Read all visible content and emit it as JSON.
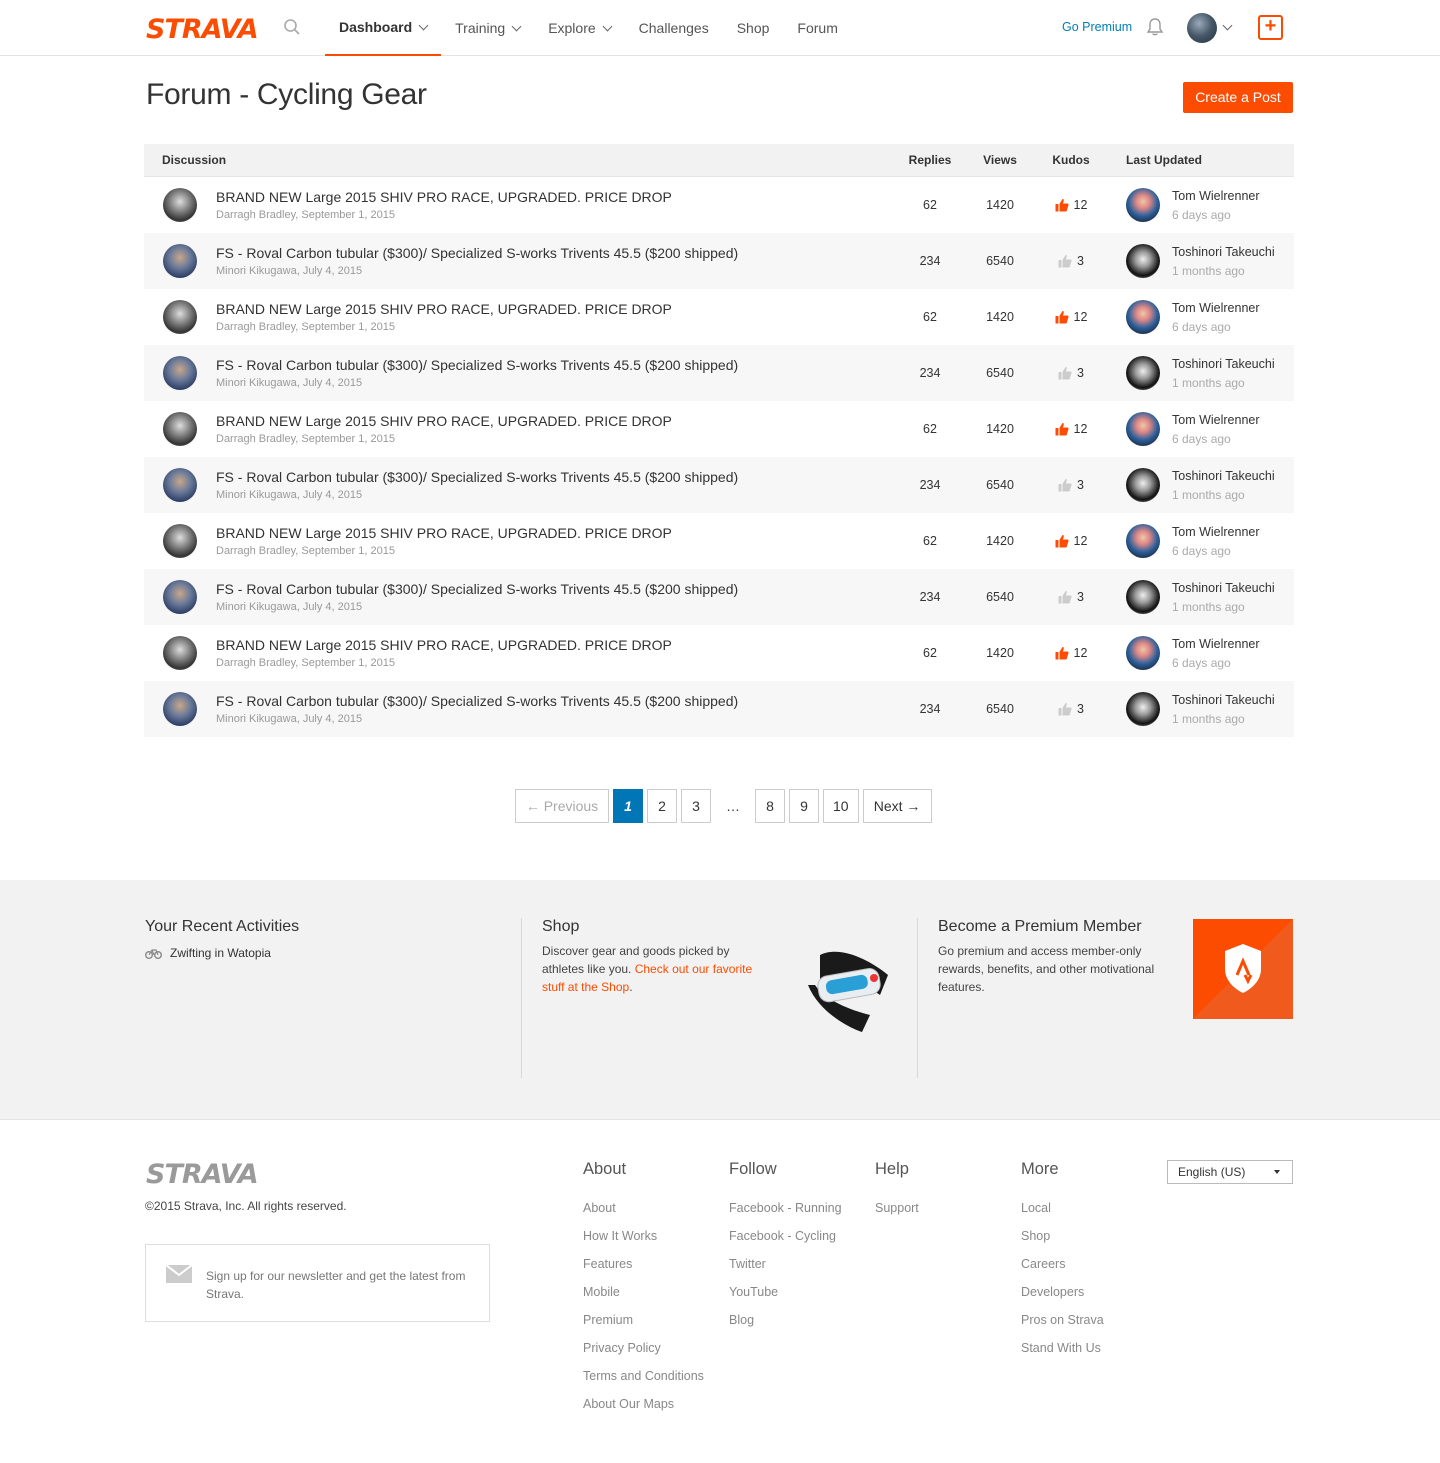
{
  "brand": {
    "logo_text": "STRAVA",
    "accent": "#fc4c02",
    "link_blue": "#007fb6"
  },
  "nav": {
    "items": [
      {
        "label": "Dashboard",
        "dropdown": true,
        "active": true
      },
      {
        "label": "Training",
        "dropdown": true,
        "active": false
      },
      {
        "label": "Explore",
        "dropdown": true,
        "active": false
      },
      {
        "label": "Challenges",
        "dropdown": false,
        "active": false
      },
      {
        "label": "Shop",
        "dropdown": false,
        "active": false
      },
      {
        "label": "Forum",
        "dropdown": false,
        "active": false
      }
    ],
    "go_premium": "Go Premium",
    "upload_symbol": "+"
  },
  "page": {
    "title": "Forum - Cycling Gear",
    "create_post": "Create a Post"
  },
  "table": {
    "headers": {
      "discussion": "Discussion",
      "replies": "Replies",
      "views": "Views",
      "kudos": "Kudos",
      "last_updated": "Last Updated"
    },
    "rows": [
      {
        "title": "BRAND NEW Large 2015 SHIV PRO RACE, UPGRADED. PRICE DROP",
        "meta": "Darragh Bradley, September 1, 2015",
        "replies": "62",
        "views": "1420",
        "kudos": "12",
        "kudos_active": true,
        "last_name": "Tom Wielrenner",
        "last_time": "6 days ago"
      },
      {
        "title": "FS - Roval Carbon tubular ($300)/ Specialized S-works Trivents 45.5 ($200 shipped)",
        "meta": "Minori Kikugawa, July 4, 2015",
        "replies": "234",
        "views": "6540",
        "kudos": "3",
        "kudos_active": false,
        "last_name": "Toshinori Takeuchi",
        "last_time": "1 months ago"
      },
      {
        "title": "BRAND NEW Large 2015 SHIV PRO RACE, UPGRADED. PRICE DROP",
        "meta": "Darragh Bradley, September 1, 2015",
        "replies": "62",
        "views": "1420",
        "kudos": "12",
        "kudos_active": true,
        "last_name": "Tom Wielrenner",
        "last_time": "6 days ago"
      },
      {
        "title": "FS - Roval Carbon tubular ($300)/ Specialized S-works Trivents 45.5 ($200 shipped)",
        "meta": "Minori Kikugawa, July 4, 2015",
        "replies": "234",
        "views": "6540",
        "kudos": "3",
        "kudos_active": false,
        "last_name": "Toshinori Takeuchi",
        "last_time": "1 months ago"
      },
      {
        "title": "BRAND NEW Large 2015 SHIV PRO RACE, UPGRADED. PRICE DROP",
        "meta": "Darragh Bradley, September 1, 2015",
        "replies": "62",
        "views": "1420",
        "kudos": "12",
        "kudos_active": true,
        "last_name": "Tom Wielrenner",
        "last_time": "6 days ago"
      },
      {
        "title": "FS - Roval Carbon tubular ($300)/ Specialized S-works Trivents 45.5 ($200 shipped)",
        "meta": "Minori Kikugawa, July 4, 2015",
        "replies": "234",
        "views": "6540",
        "kudos": "3",
        "kudos_active": false,
        "last_name": "Toshinori Takeuchi",
        "last_time": "1 months ago"
      },
      {
        "title": "BRAND NEW Large 2015 SHIV PRO RACE, UPGRADED. PRICE DROP",
        "meta": "Darragh Bradley, September 1, 2015",
        "replies": "62",
        "views": "1420",
        "kudos": "12",
        "kudos_active": true,
        "last_name": "Tom Wielrenner",
        "last_time": "6 days ago"
      },
      {
        "title": "FS - Roval Carbon tubular ($300)/ Specialized S-works Trivents 45.5 ($200 shipped)",
        "meta": "Minori Kikugawa, July 4, 2015",
        "replies": "234",
        "views": "6540",
        "kudos": "3",
        "kudos_active": false,
        "last_name": "Toshinori Takeuchi",
        "last_time": "1 months ago"
      },
      {
        "title": "BRAND NEW Large 2015 SHIV PRO RACE, UPGRADED. PRICE DROP",
        "meta": "Darragh Bradley, September 1, 2015",
        "replies": "62",
        "views": "1420",
        "kudos": "12",
        "kudos_active": true,
        "last_name": "Tom Wielrenner",
        "last_time": "6 days ago"
      },
      {
        "title": "FS - Roval Carbon tubular ($300)/ Specialized S-works Trivents 45.5 ($200 shipped)",
        "meta": "Minori Kikugawa, July 4, 2015",
        "replies": "234",
        "views": "6540",
        "kudos": "3",
        "kudos_active": false,
        "last_name": "Toshinori Takeuchi",
        "last_time": "1 months ago"
      }
    ]
  },
  "pagination": {
    "previous": "← Previous",
    "pages": [
      "1",
      "2",
      "3",
      "…",
      "8",
      "9",
      "10"
    ],
    "current": "1",
    "next": "Next →"
  },
  "band": {
    "recent": {
      "title": "Your Recent Activities",
      "items": [
        "Zwifting in Watopia"
      ]
    },
    "shop": {
      "title": "Shop",
      "text": "Discover gear and goods picked by athletes like you. ",
      "link": "Check out our favorite stuff at the Shop",
      "suffix": "."
    },
    "premium": {
      "title": "Become a Premium Member",
      "text": "Go premium and access member-only rewards, benefits, and other motivational features."
    }
  },
  "footer": {
    "logo_text": "STRAVA",
    "copyright": "©2015 Strava, Inc. All rights reserved.",
    "newsletter": "Sign up for our newsletter and get the latest from Strava.",
    "columns": [
      {
        "title": "About",
        "links": [
          "About",
          "How It Works",
          "Features",
          "Mobile",
          "Premium",
          "Privacy Policy",
          "Terms and Conditions",
          "About Our Maps"
        ]
      },
      {
        "title": "Follow",
        "links": [
          "Facebook - Running",
          "Facebook - Cycling",
          "Twitter",
          "YouTube",
          "Blog"
        ]
      },
      {
        "title": "Help",
        "links": [
          "Support"
        ]
      },
      {
        "title": "More",
        "links": [
          "Local",
          "Shop",
          "Careers",
          "Developers",
          "Pros on Strava",
          "Stand With Us"
        ]
      }
    ],
    "language": "English (US)"
  }
}
